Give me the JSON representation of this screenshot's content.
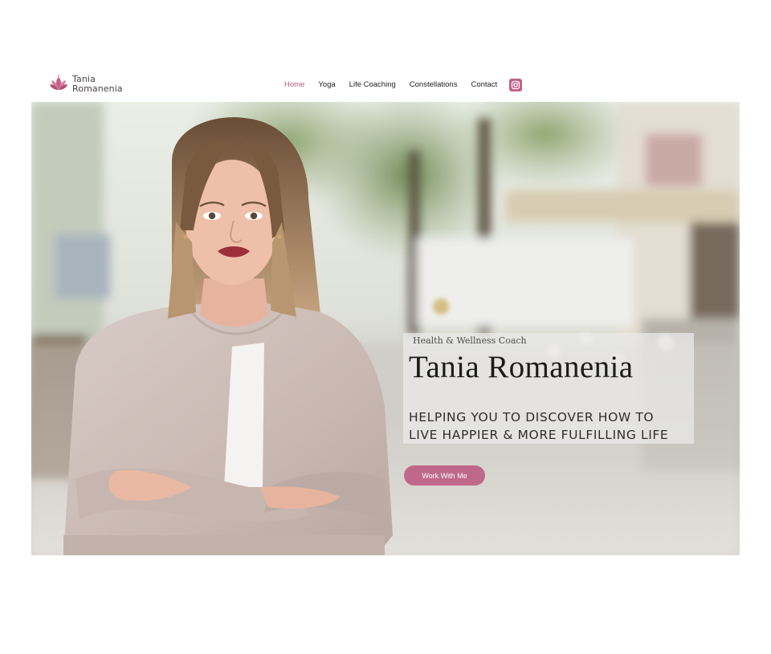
{
  "brand": {
    "name_line1": "Tania",
    "name_line2": "Romanenia",
    "logo_icon": "lotus-icon",
    "accent_color": "#c65f88"
  },
  "nav": {
    "items": [
      {
        "label": "Home",
        "active": true
      },
      {
        "label": "Yoga",
        "active": false
      },
      {
        "label": "Life Coaching",
        "active": false
      },
      {
        "label": "Constellations",
        "active": false
      },
      {
        "label": "Contact",
        "active": false
      }
    ],
    "social_icon": "instagram-icon"
  },
  "hero": {
    "kicker": "Health & Wellness Coach",
    "title": "Tania Romanenia",
    "tagline_line1": "HELPING YOU TO DISCOVER HOW TO",
    "tagline_line2": "LIVE HAPPIER & MORE FULFILLING LIFE",
    "cta_label": "Work With Me"
  }
}
